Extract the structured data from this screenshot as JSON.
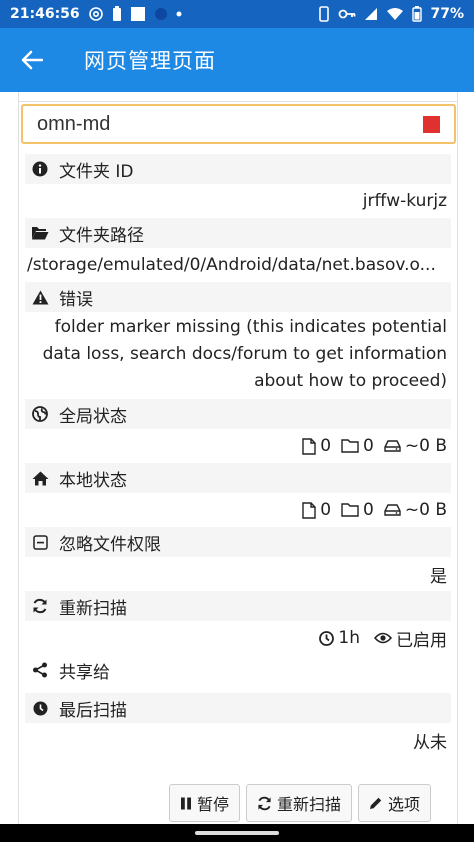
{
  "status_bar": {
    "time": "21:46:56",
    "battery": "77%"
  },
  "app_bar": {
    "title": "网页管理页面"
  },
  "folder": {
    "name": "omn-md",
    "status_color": "#e03131"
  },
  "rows": {
    "folder_id": {
      "label": "文件夹 ID",
      "value": "jrffw-kurjz"
    },
    "folder_path": {
      "label": "文件夹路径",
      "value": "/storage/emulated/0/Android/data/net.basov.o..."
    },
    "error": {
      "label": "错误",
      "value": "folder marker missing (this indicates potential data loss, search docs/forum to get information about how to proceed)"
    },
    "global_state": {
      "label": "全局状态",
      "files": "0",
      "dirs": "0",
      "size": "~0 B"
    },
    "local_state": {
      "label": "本地状态",
      "files": "0",
      "dirs": "0",
      "size": "~0 B"
    },
    "ignore_perms": {
      "label": "忽略文件权限",
      "value": "是"
    },
    "rescan": {
      "label": "重新扫描",
      "interval": "1h",
      "watch": "已启用"
    },
    "shared_with": {
      "label": "共享给"
    },
    "last_scan": {
      "label": "最后扫描",
      "value": "从未"
    }
  },
  "buttons": {
    "pause": "暂停",
    "rescan": "重新扫描",
    "options": "选项"
  },
  "colors": {
    "app_bar": "#1e88e5",
    "status_bar": "#1565c0",
    "folder_border": "#f5c26b"
  }
}
